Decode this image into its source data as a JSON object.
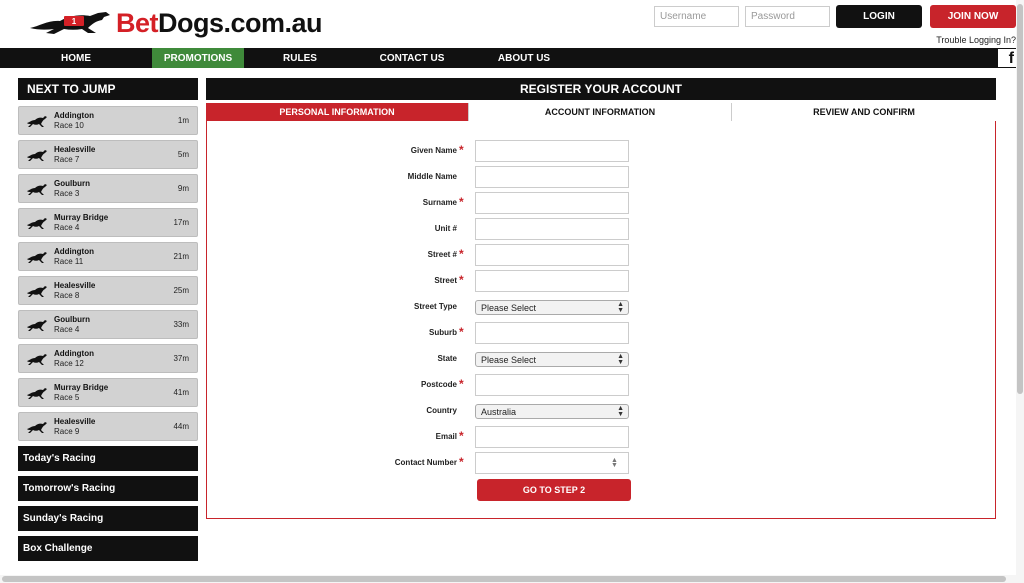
{
  "header": {
    "logo_text_red": "Bet",
    "logo_text_black": "Dogs.com.au",
    "logo_badge": "1",
    "username_placeholder": "Username",
    "password_placeholder": "Password",
    "login_label": "LOGIN",
    "join_label": "JOIN NOW",
    "trouble_label": "Trouble Logging In?"
  },
  "nav": {
    "items": [
      "HOME",
      "PROMOTIONS",
      "RULES",
      "CONTACT US",
      "ABOUT US"
    ],
    "active": "PROMOTIONS",
    "facebook_glyph": "f"
  },
  "sidebar": {
    "title": "NEXT TO JUMP",
    "races": [
      {
        "track": "Addington",
        "race": "Race 10",
        "time": "1m"
      },
      {
        "track": "Healesville",
        "race": "Race 7",
        "time": "5m"
      },
      {
        "track": "Goulburn",
        "race": "Race 3",
        "time": "9m"
      },
      {
        "track": "Murray Bridge",
        "race": "Race 4",
        "time": "17m"
      },
      {
        "track": "Addington",
        "race": "Race 11",
        "time": "21m"
      },
      {
        "track": "Healesville",
        "race": "Race 8",
        "time": "25m"
      },
      {
        "track": "Goulburn",
        "race": "Race 4",
        "time": "33m"
      },
      {
        "track": "Addington",
        "race": "Race 12",
        "time": "37m"
      },
      {
        "track": "Murray Bridge",
        "race": "Race 5",
        "time": "41m"
      },
      {
        "track": "Healesville",
        "race": "Race 9",
        "time": "44m"
      }
    ],
    "links": [
      "Today's Racing",
      "Tomorrow's Racing",
      "Sunday's Racing",
      "Box Challenge"
    ]
  },
  "main": {
    "title": "REGISTER YOUR ACCOUNT",
    "tabs": [
      "PERSONAL INFORMATION",
      "ACCOUNT INFORMATION",
      "REVIEW AND CONFIRM"
    ],
    "active_tab": "PERSONAL INFORMATION",
    "required_mark": "*",
    "fields": {
      "given_name": {
        "label": "Given Name"
      },
      "middle_name": {
        "label": "Middle Name"
      },
      "surname": {
        "label": "Surname"
      },
      "unit": {
        "label": "Unit #"
      },
      "street_no": {
        "label": "Street #"
      },
      "street": {
        "label": "Street"
      },
      "street_type": {
        "label": "Street Type",
        "value": "Please Select"
      },
      "suburb": {
        "label": "Suburb"
      },
      "state": {
        "label": "State",
        "value": "Please Select"
      },
      "postcode": {
        "label": "Postcode"
      },
      "country": {
        "label": "Country",
        "value": "Australia"
      },
      "email": {
        "label": "Email"
      },
      "contact_number": {
        "label": "Contact Number"
      }
    },
    "submit_label": "GO TO STEP 2"
  },
  "colors": {
    "brand_red": "#c8242b",
    "nav_active_green": "#3f8a3a",
    "dark": "#111111"
  }
}
